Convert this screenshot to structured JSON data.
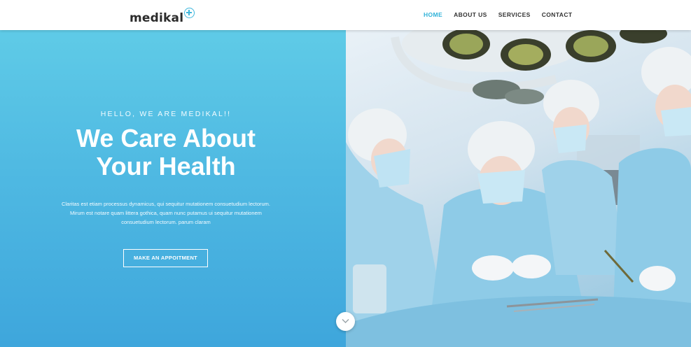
{
  "brand": {
    "name": "medikal",
    "accent_color": "#2fb2d8"
  },
  "nav": {
    "items": [
      {
        "label": "HOME",
        "active": true
      },
      {
        "label": "ABOUT US",
        "active": false
      },
      {
        "label": "SERVICES",
        "active": false
      },
      {
        "label": "CONTACT",
        "active": false
      }
    ]
  },
  "hero": {
    "eyebrow": "HELLO, WE ARE MEDIKAL!!",
    "headline_line1": "We Care About",
    "headline_line2": "Your Health",
    "body_line1": "Claritas est etiam processus dynamicus, qui sequitur mutationem consuetudium lectorum.",
    "body_line2": "Mirum est notare quam littera gothica, quam nunc putamus ui sequitur mutationem",
    "body_line3": "consuetudium lectorum. parum claram",
    "cta_label": "MAKE AN APPOITMENT",
    "gradient_top": "#5fcbe7",
    "gradient_bottom": "#3ea6dc",
    "image_icon": "surgeons-operating-photo"
  },
  "scroll": {
    "icon": "chevron-down-icon"
  }
}
